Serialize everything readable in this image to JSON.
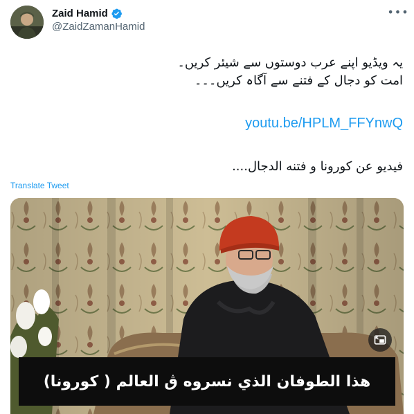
{
  "author": {
    "display_name": "Zaid Hamid",
    "handle": "@ZaidZamanHamid",
    "verified_icon": "verified-badge-icon",
    "verified_color": "#1d9bf0"
  },
  "menu": {
    "icon": "more-options-icon",
    "glyph": "•••"
  },
  "tweet": {
    "line1": "یہ ویڈیو اپنے عرب دوستوں سے شیئر کریں۔",
    "line2": "امت کو دجال کے فتنے سے آگاہ کریں۔۔۔",
    "link": "youtu.be/HPLM_FFYnwQ",
    "line3": "فيديو عن كورونا و فتنه الدجال....",
    "translate": "Translate Tweet",
    "link_color": "#1d9bf0"
  },
  "media": {
    "caption": "هذا الطوفان الذي نسروه ڨ العالم ( كورونا)",
    "pip_icon": "picture-in-picture-icon"
  }
}
